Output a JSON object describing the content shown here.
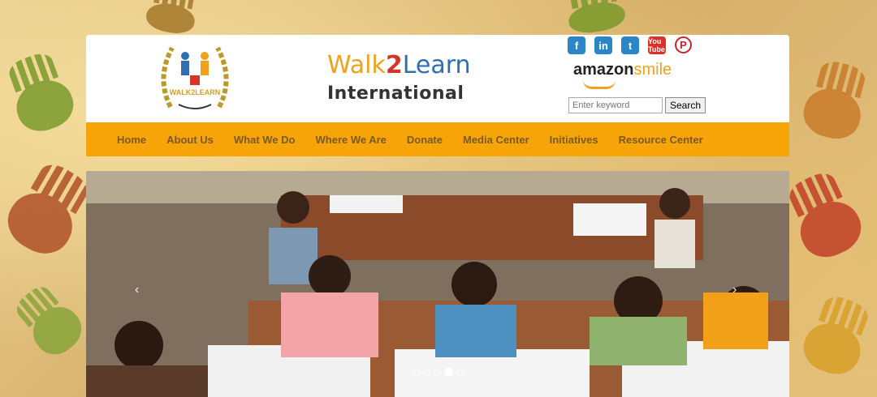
{
  "brand": {
    "logo_text": "WALK2LEARN",
    "name_part1": "Walk",
    "name_part2": "2",
    "name_part3": "Learn",
    "subtitle": "International"
  },
  "social": {
    "facebook": "f",
    "linkedin": "in",
    "twitter": "t",
    "youtube": "You Tube",
    "pinterest": "P"
  },
  "amazon": {
    "amazon": "amazon",
    "smile": "smile"
  },
  "search": {
    "placeholder": "Enter keyword",
    "button_label": "Search"
  },
  "nav": {
    "items": [
      "Home",
      "About Us",
      "What We Do",
      "Where We Are",
      "Donate",
      "Media Center",
      "Initiatives",
      "Resource Center"
    ]
  },
  "slider": {
    "prev": "‹",
    "next": "›",
    "slide_count": 5,
    "active_slide": 4
  },
  "colors": {
    "nav_bg": "#f7a408",
    "nav_text": "#7a5a24",
    "brand_orange": "#f0a21d",
    "brand_red": "#d4342a",
    "brand_blue": "#2f6fb1"
  }
}
